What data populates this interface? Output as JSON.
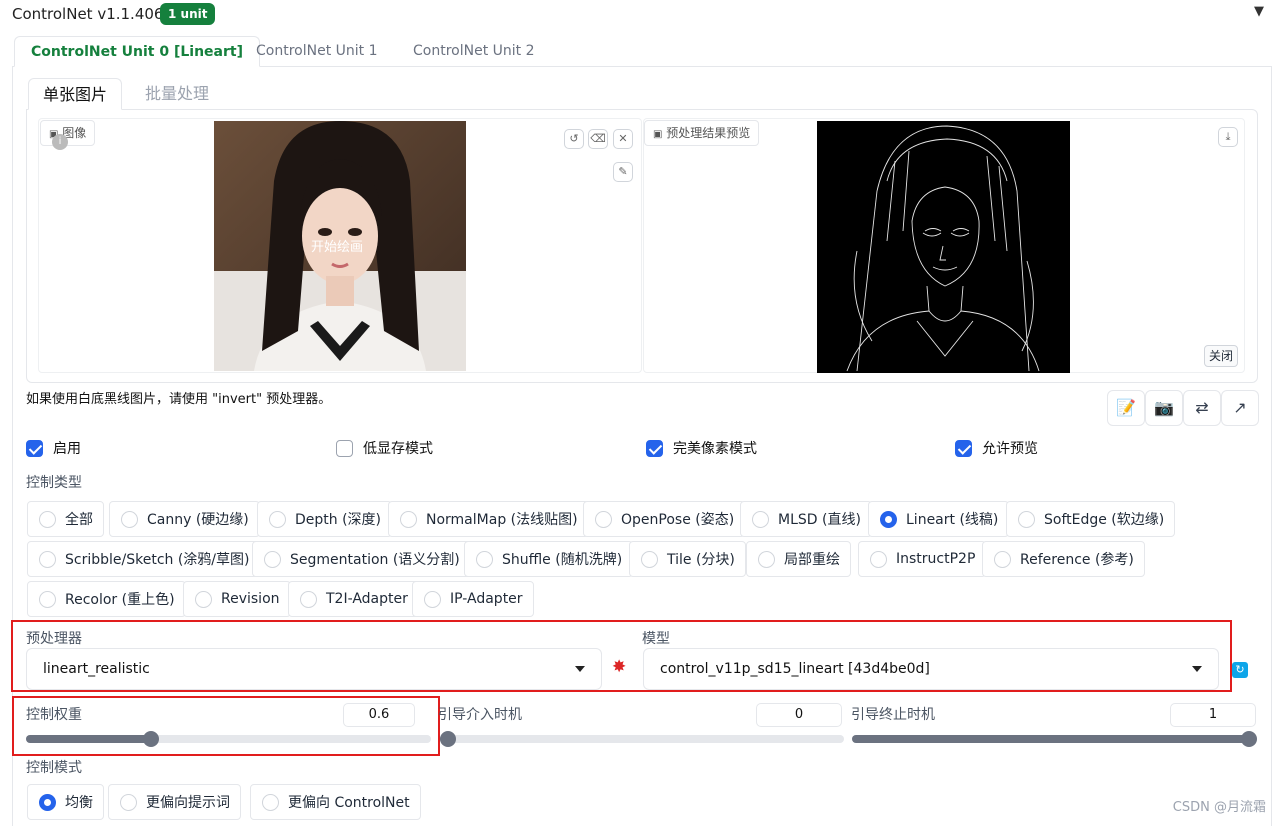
{
  "header": {
    "title": "ControlNet v1.1.406",
    "badge": "1 unit"
  },
  "unit_tabs": [
    {
      "label": "ControlNet Unit 0 [Lineart]",
      "active": true
    },
    {
      "label": "ControlNet Unit 1",
      "active": false
    },
    {
      "label": "ControlNet Unit 2",
      "active": false
    }
  ],
  "sub_tabs": [
    {
      "label": "单张图片",
      "active": true
    },
    {
      "label": "批量处理",
      "active": false
    }
  ],
  "image_panel": {
    "label": "图像",
    "overlay_text": "开始绘画",
    "tools": [
      "undo-icon",
      "eraser-icon",
      "close-icon",
      "brush-icon"
    ]
  },
  "preview_panel": {
    "label": "预处理结果预览",
    "close_label": "关闭",
    "download_icon": "download-icon"
  },
  "hint": "如果使用白底黑线图片，请使用 \"invert\" 预处理器。",
  "action_icons": [
    "edit-icon",
    "camera-icon",
    "swap-icon",
    "send-icon"
  ],
  "checkboxes": [
    {
      "label": "启用",
      "checked": true
    },
    {
      "label": "低显存模式",
      "checked": false
    },
    {
      "label": "完美像素模式",
      "checked": true
    },
    {
      "label": "允许预览",
      "checked": true
    }
  ],
  "control_type": {
    "label": "控制类型",
    "options": [
      {
        "label": "全部",
        "selected": false
      },
      {
        "label": "Canny (硬边缘)",
        "selected": false
      },
      {
        "label": "Depth (深度)",
        "selected": false
      },
      {
        "label": "NormalMap (法线贴图)",
        "selected": false
      },
      {
        "label": "OpenPose (姿态)",
        "selected": false
      },
      {
        "label": "MLSD (直线)",
        "selected": false
      },
      {
        "label": "Lineart (线稿)",
        "selected": true
      },
      {
        "label": "SoftEdge (软边缘)",
        "selected": false
      },
      {
        "label": "Scribble/Sketch (涂鸦/草图)",
        "selected": false
      },
      {
        "label": "Segmentation (语义分割)",
        "selected": false
      },
      {
        "label": "Shuffle (随机洗牌)",
        "selected": false
      },
      {
        "label": "Tile (分块)",
        "selected": false
      },
      {
        "label": "局部重绘",
        "selected": false
      },
      {
        "label": "InstructP2P",
        "selected": false
      },
      {
        "label": "Reference (参考)",
        "selected": false
      },
      {
        "label": "Recolor (重上色)",
        "selected": false
      },
      {
        "label": "Revision",
        "selected": false
      },
      {
        "label": "T2I-Adapter",
        "selected": false
      },
      {
        "label": "IP-Adapter",
        "selected": false
      }
    ]
  },
  "preprocessor": {
    "label": "预处理器",
    "value": "lineart_realistic"
  },
  "model": {
    "label": "模型",
    "value": "control_v11p_sd15_lineart [43d4be0d]"
  },
  "sliders": {
    "weight": {
      "label": "控制权重",
      "value": "0.6",
      "fraction": 0.3
    },
    "start": {
      "label": "引导介入时机",
      "value": "0",
      "fraction": 0.0
    },
    "end": {
      "label": "引导终止时机",
      "value": "1",
      "fraction": 1.0
    }
  },
  "control_mode": {
    "label": "控制模式",
    "options": [
      {
        "label": "均衡",
        "selected": true
      },
      {
        "label": "更偏向提示词",
        "selected": false
      },
      {
        "label": "更偏向 ControlNet",
        "selected": false
      }
    ]
  },
  "watermark": "CSDN @月流霜",
  "colors": {
    "accent": "#2563eb",
    "brand_green": "#15803d",
    "highlight": "#e11d1d"
  }
}
